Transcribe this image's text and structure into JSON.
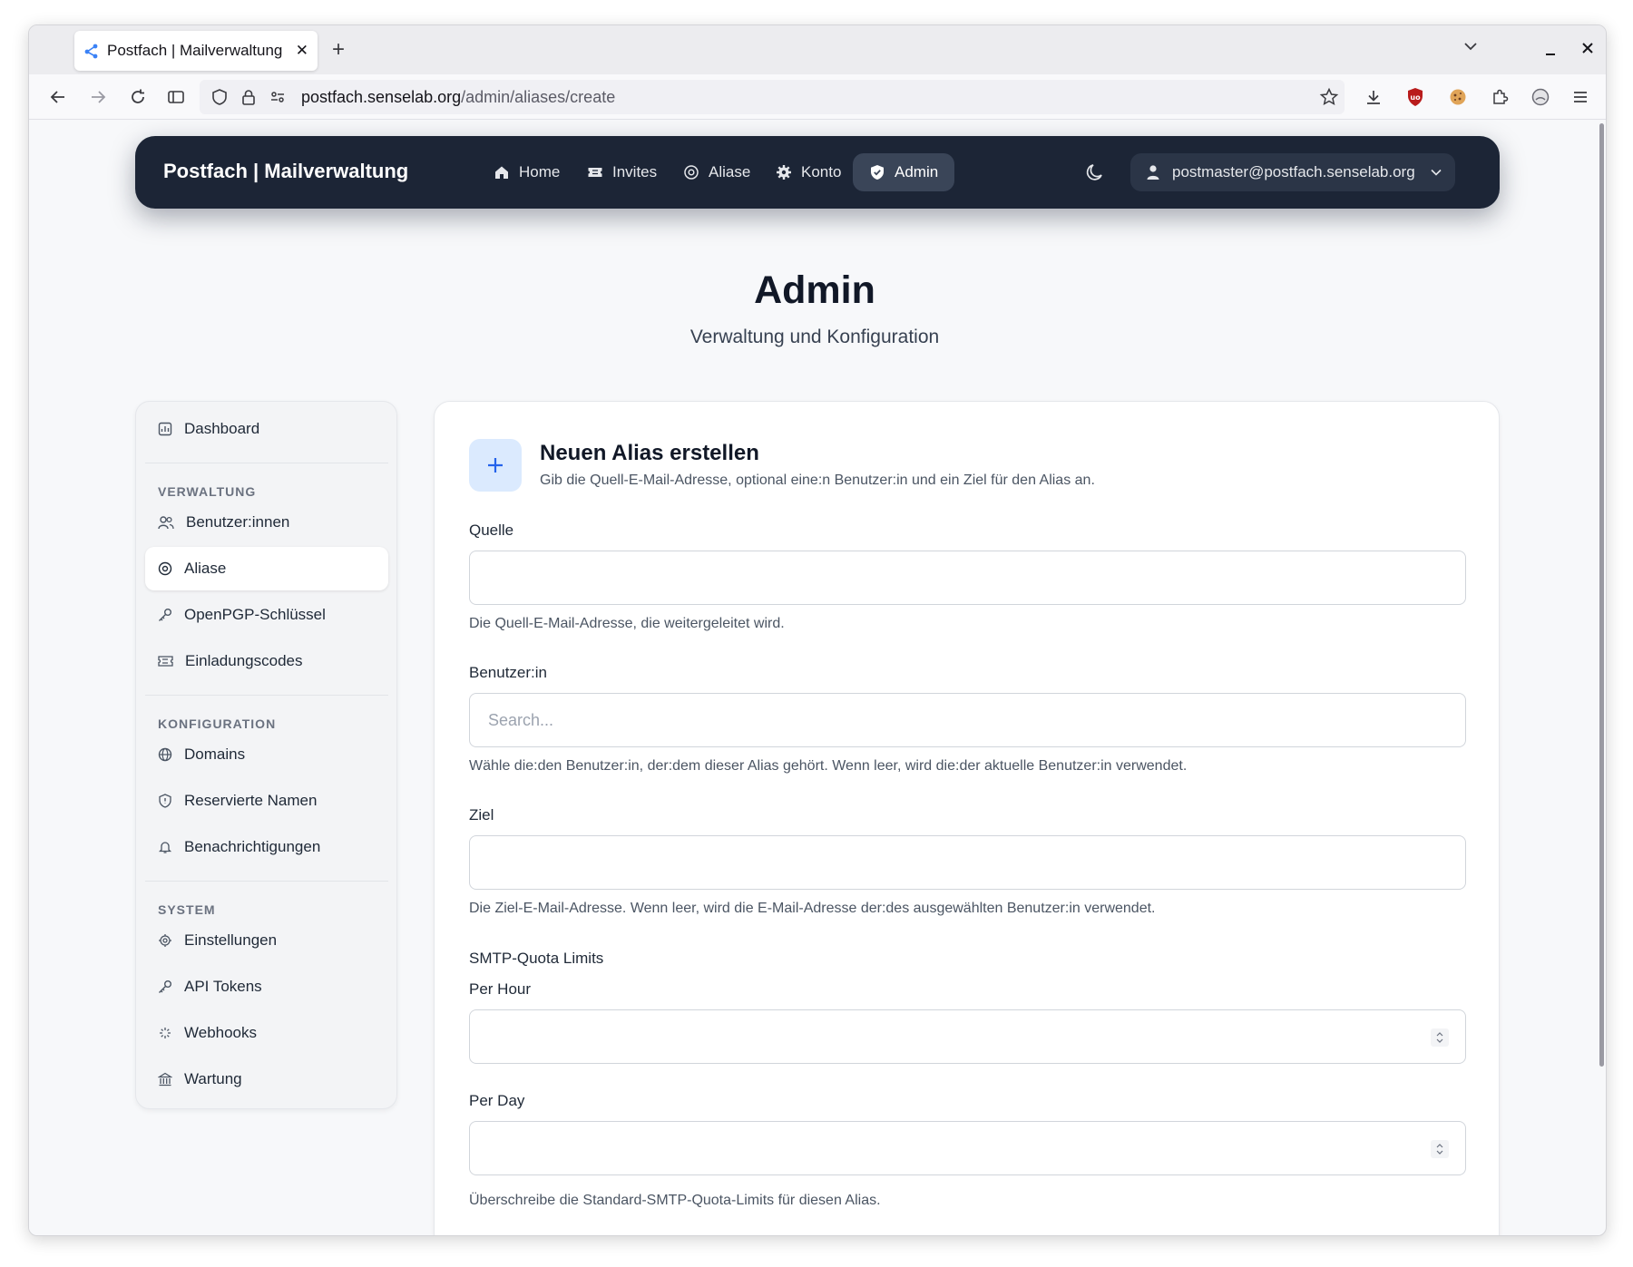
{
  "browser": {
    "tab_title": "Postfach | Mailverwaltung",
    "tab_close": "✕",
    "new_tab": "+",
    "url_host": "postfach.senselab.org",
    "url_path": "/admin/aliases/create"
  },
  "app": {
    "brand": "Postfach | Mailverwaltung",
    "nav": [
      {
        "label": "Home",
        "icon": "home-icon"
      },
      {
        "label": "Invites",
        "icon": "ticket-icon"
      },
      {
        "label": "Aliase",
        "icon": "at-icon"
      },
      {
        "label": "Konto",
        "icon": "gear-icon"
      },
      {
        "label": "Admin",
        "icon": "shield-icon",
        "active": true
      }
    ],
    "user_email": "postmaster@postfach.senselab.org"
  },
  "page": {
    "title": "Admin",
    "subtitle": "Verwaltung und Konfiguration"
  },
  "sidebar": {
    "dashboard": "Dashboard",
    "sections": [
      {
        "heading": "VERWALTUNG",
        "items": [
          "Benutzer:innen",
          "Aliase",
          "OpenPGP-Schlüssel",
          "Einladungscodes"
        ]
      },
      {
        "heading": "KONFIGURATION",
        "items": [
          "Domains",
          "Reservierte Namen",
          "Benachrichtigungen"
        ]
      },
      {
        "heading": "SYSTEM",
        "items": [
          "Einstellungen",
          "API Tokens",
          "Webhooks",
          "Wartung"
        ]
      }
    ],
    "active_item": "Aliase"
  },
  "form": {
    "title": "Neuen Alias erstellen",
    "description": "Gib die Quell-E-Mail-Adresse, optional eine:n Benutzer:in und ein Ziel für den Alias an.",
    "source_label": "Quelle",
    "source_value": "",
    "source_help": "Die Quell-E-Mail-Adresse, die weitergeleitet wird.",
    "user_label": "Benutzer:in",
    "user_placeholder": "Search...",
    "user_help": "Wähle die:den Benutzer:in, der:dem dieser Alias gehört. Wenn leer, wird die:der aktuelle Benutzer:in verwendet.",
    "target_label": "Ziel",
    "target_value": "",
    "target_help": "Die Ziel-E-Mail-Adresse. Wenn leer, wird die E-Mail-Adresse der:des ausgewählten Benutzer:in verwendet.",
    "quota_heading": "SMTP-Quota Limits",
    "per_hour_label": "Per Hour",
    "per_day_label": "Per Day",
    "quota_help": "Überschreibe die Standard-SMTP-Quota-Limits für diesen Alias."
  },
  "colors": {
    "nav_bg": "#1c2536",
    "accent": "#2563eb",
    "accent_soft": "#dbeafe"
  }
}
